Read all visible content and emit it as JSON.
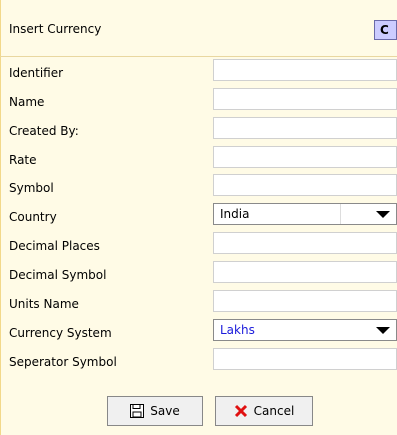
{
  "dialog": {
    "title": "Insert Currency",
    "corner_button": "C"
  },
  "form": {
    "labels": {
      "identifier": "Identifier",
      "name": "Name",
      "created_by": "Created By:",
      "rate": "Rate",
      "symbol": "Symbol",
      "country": "Country",
      "decimal_places": "Decimal Places",
      "decimal_symbol": "Decimal Symbol",
      "units_name": "Units Name",
      "currency_system": "Currency System",
      "separator_symbol": "Seperator Symbol"
    },
    "values": {
      "identifier": "",
      "name": "",
      "created_by": "",
      "rate": "",
      "symbol": "",
      "country": "India",
      "decimal_places": "",
      "decimal_symbol": "",
      "units_name": "",
      "currency_system": "Lakhs",
      "separator_symbol": ""
    }
  },
  "buttons": {
    "save": "Save",
    "cancel": "Cancel"
  },
  "colors": {
    "background": "#fffbe6",
    "currency_system_text": "#1a1adb",
    "cancel_icon": "#e01010"
  }
}
